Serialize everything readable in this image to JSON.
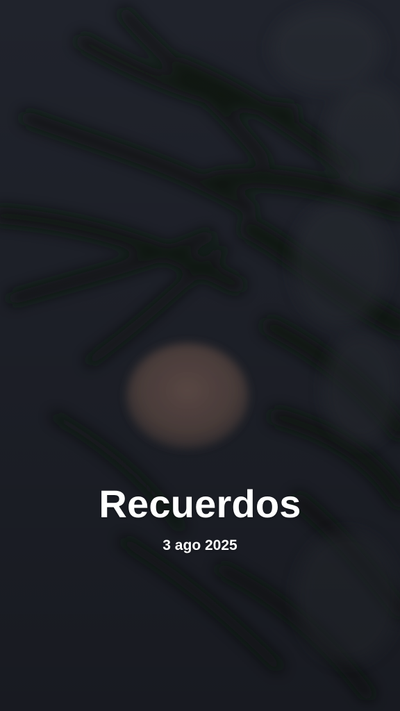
{
  "memory": {
    "title": "Recuerdos",
    "date": "3 ago 2025"
  },
  "colors": {
    "background": "#1f222b",
    "text": "#ffffff",
    "moon": "#5e4a45"
  }
}
